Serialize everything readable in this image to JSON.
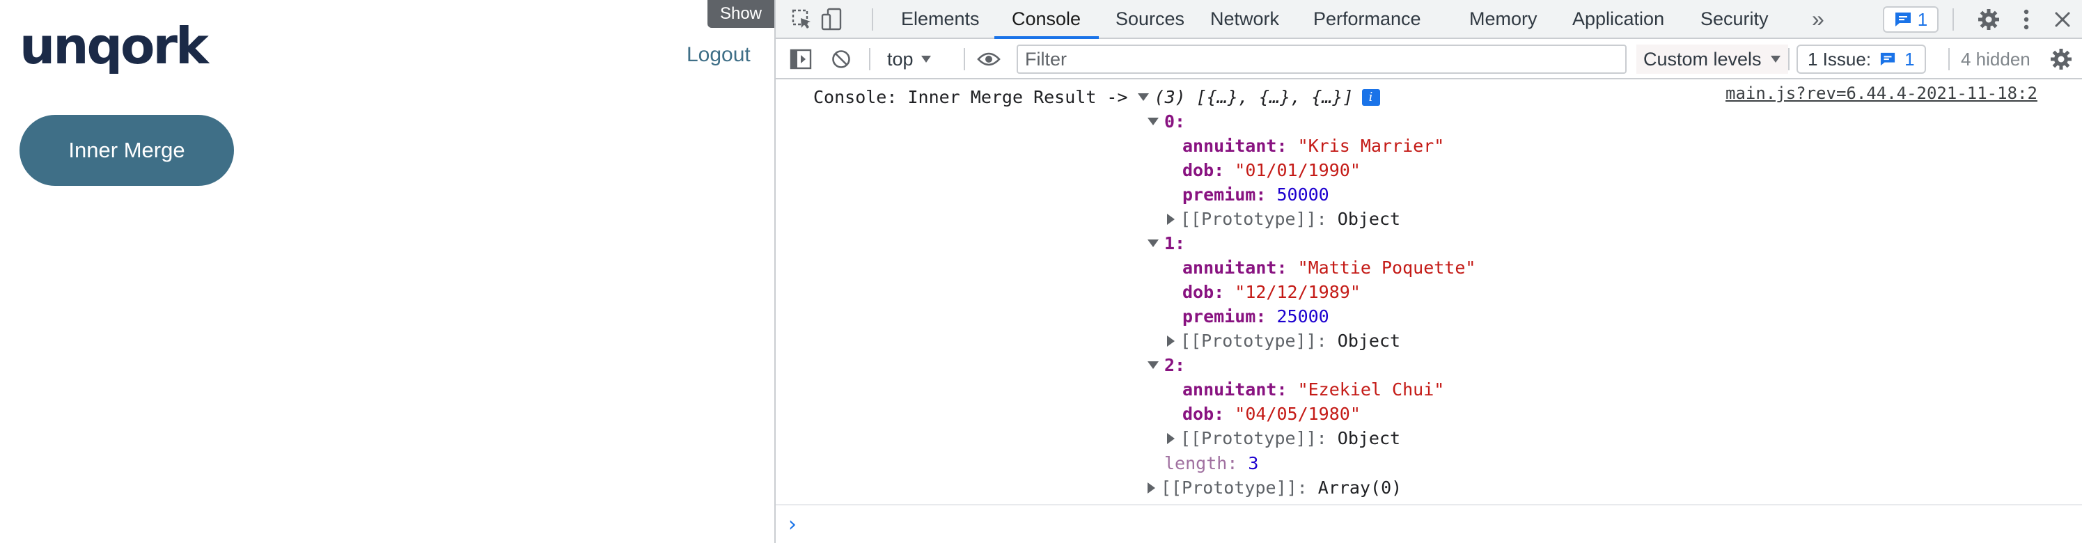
{
  "app": {
    "logo": "unqork",
    "logout_label": "Logout",
    "show_label": "Show",
    "inner_merge_label": "Inner Merge",
    "brand_color": "#3f6f87"
  },
  "devtools": {
    "tabs": [
      {
        "label": "Elements",
        "active": false
      },
      {
        "label": "Console",
        "active": true
      },
      {
        "label": "Sources",
        "active": false
      },
      {
        "label": "Network",
        "active": false
      },
      {
        "label": "Performance",
        "active": false
      },
      {
        "label": "Memory",
        "active": false
      },
      {
        "label": "Application",
        "active": false
      },
      {
        "label": "Security",
        "active": false
      }
    ],
    "more_tabs_glyph": "»",
    "message_count": "1",
    "toolbar": {
      "context": "top",
      "filter_placeholder": "Filter",
      "levels": "Custom levels",
      "issues_label": "1 Issue:",
      "issues_count": "1",
      "hidden": "4 hidden"
    },
    "console": {
      "message_prefix": "Console: Inner Merge Result ->",
      "array_summary": "(3) [{…}, {…}, {…}]",
      "info_badge": "i",
      "source": "main.js?rev=6.44.4-2021-11-18:2",
      "entries": [
        {
          "index": "0:",
          "annutant_key": "annuitant",
          "annuitant": "\"Kris Marrier\"",
          "dob_key": "dob",
          "dob": "\"01/01/1990\"",
          "premium_key": "premium",
          "premium": "50000",
          "proto": "[[Prototype]]",
          "proto_value": "Object"
        },
        {
          "index": "1:",
          "annutant_key": "annuitant",
          "annuitant": "\"Mattie Poquette\"",
          "dob_key": "dob",
          "dob": "\"12/12/1989\"",
          "premium_key": "premium",
          "premium": "25000",
          "proto": "[[Prototype]]",
          "proto_value": "Object"
        },
        {
          "index": "2:",
          "annutant_key": "annuitant",
          "annuitant": "\"Ezekiel Chui\"",
          "dob_key": "dob",
          "dob": "\"04/05/1980\"",
          "proto": "[[Prototype]]",
          "proto_value": "Object"
        }
      ],
      "length_key": "length",
      "length_value": "3",
      "array_proto": "[[Prototype]]",
      "array_proto_value": "Array(0)",
      "prompt": "›"
    }
  }
}
